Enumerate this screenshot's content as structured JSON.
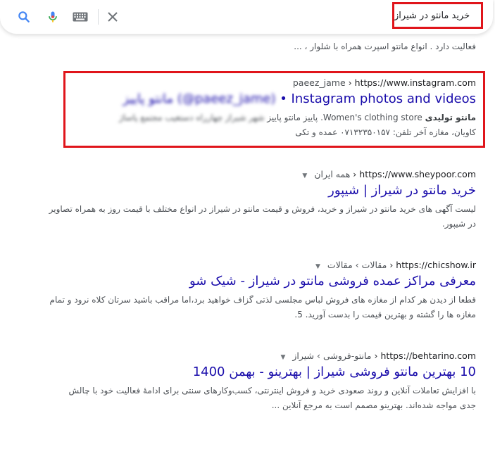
{
  "search": {
    "query": "خرید مانتو در شیراز"
  },
  "icons": [
    "search-icon",
    "mic-icon",
    "keyboard-icon",
    "close-icon"
  ],
  "results": [
    {
      "snippet_l2": "فعالیت دارد . انواع مانتو اسپرت همراه با شلوار ، ..."
    },
    {
      "cite_domain": "https://www.instagram.com",
      "cite_path": "paeez_jame",
      "title_main": "• Instagram photos and videos",
      "title_blurred": "مانتو پاییز (@paeez_jame)",
      "snippet_l1_visible": "Women's clothing store. پاییز مانتو پاییز",
      "snippet_l1_prefix": "مانتو تولیدی",
      "snippet_l1_blurred": "شهر شیراز چهارراه دستغیب مجتمع پاساژ",
      "snippet_l2": "کاویان، مغازه آخر تلفن: ۰۷۱۳۲۳۵۰۱۵۷ عمده و تکی"
    },
    {
      "cite_domain": "https://www.sheypoor.com",
      "cite_path": "همه ایران",
      "title": "خرید مانتو در شیراز | شیپور",
      "snippet_l1": "لیست آگهی های خرید مانتو در شیراز و خرید، فروش و قیمت مانتو در شیراز در انواع مختلف با قیمت روز به همراه تصاویر",
      "snippet_l2": "در شیپور."
    },
    {
      "cite_domain": "https://chicshow.ir",
      "cite_path": "مقالات › مقالات",
      "title": "معرفی مراکز عمده فروشی مانتو در شیراز - شیک شو",
      "snippet_l1": "قطعا از دیدن هر کدام از مغازه های فروش لباس مجلسی لذتی گزاف خواهید برد،اما مراقب باشید سرتان کلاه نرود و تمام",
      "snippet_l2": "مغازه ها را گشته و بهترین قیمت را بدست آورید. 5."
    },
    {
      "cite_domain": "https://behtarino.com",
      "cite_path": "مانتو-فروشی › شیراز",
      "title": "10 بهترین مانتو فروشی شیراز | بهترینو - بهمن 1400",
      "snippet_l1": "با افزایش تعاملات آنلاین و روند صعودی خرید و فروش اینترنتی، کسب‌وکارهای سنتی برای ادامهٔ فعالیت خود با چالش",
      "snippet_l2": "جدی مواجه شده‌اند. بهترینو مصمم است به مرجع آنلاین ..."
    }
  ]
}
